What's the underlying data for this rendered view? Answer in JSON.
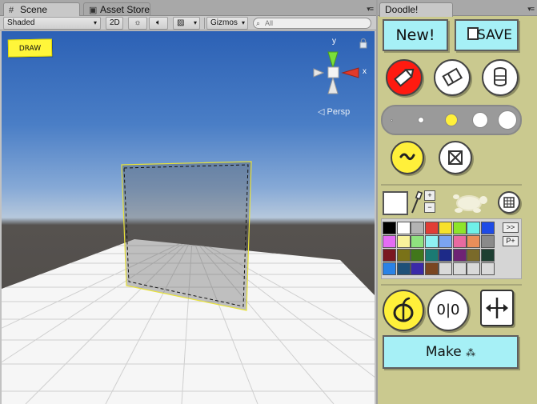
{
  "scene_panel": {
    "tabs": [
      {
        "label": "Scene",
        "icon": "hash-icon"
      },
      {
        "label": "Asset Store",
        "icon": "bag-icon"
      }
    ],
    "toolbar": {
      "shading": "Shaded",
      "btn_2d": "2D",
      "gizmos": "Gizmos",
      "search_placeholder": "All"
    },
    "gizmo": {
      "y_label": "y",
      "x_label": "x"
    },
    "persp_label": "◁ Persp",
    "draw_note": "DRAW"
  },
  "doodle_panel": {
    "tab_label": "Doodle!",
    "new_label": "New!",
    "save_label": "SAVE",
    "make_label": "Make",
    "plus": "+",
    "minus": "−",
    "next_page": ">>",
    "add_palette": "P+",
    "mirror_label": "0|0",
    "palette_rows": [
      [
        "#000000",
        "#ffffff",
        "#b3b3b3",
        "#e13d36",
        "#f7e12c",
        "#8ee52a",
        "#6ff0e8",
        "#1e4be6"
      ],
      [
        "#e46cf4",
        "#f8f29b",
        "#8fe27f",
        "#8ef1f2",
        "#7ba4f0",
        "#e86aa0",
        "#e88e5a",
        "#8a8a8a"
      ],
      [
        "#7a1820",
        "#7a7218",
        "#41771b",
        "#1b7a73",
        "#1d2a88",
        "#6e2374",
        "#7a6a2a",
        "#1e3f32"
      ],
      [
        "#2a82e6",
        "#1f5078",
        "#3b2aa8",
        "#7a4622",
        "#d9d9d9",
        "#d9d9d9",
        "#d9d9d9",
        "#d9d9d9"
      ]
    ]
  }
}
